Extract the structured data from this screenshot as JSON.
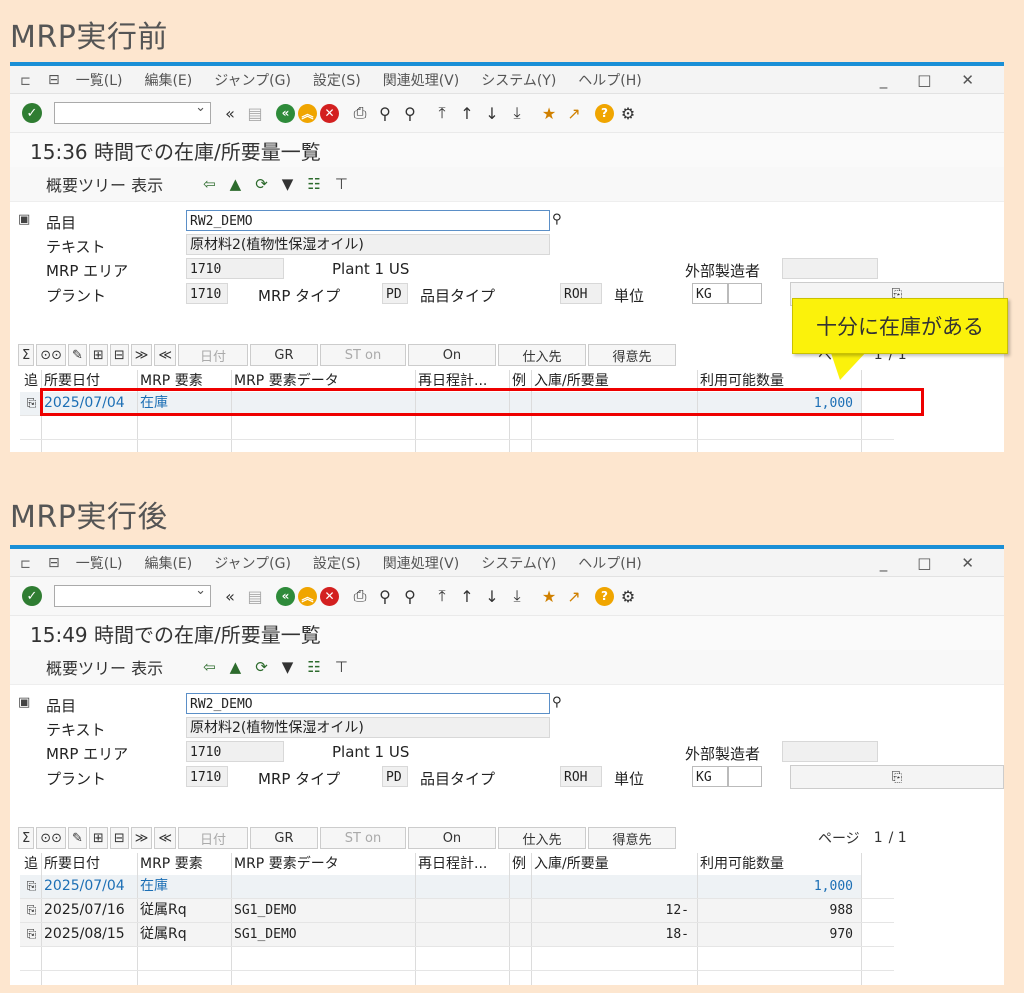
{
  "before": {
    "heading": "MRP実行前",
    "menu": [
      "一覧(L)",
      "編集(E)",
      "ジャンプ(G)",
      "設定(S)",
      "関連処理(V)",
      "システム(Y)",
      "ヘルプ(H)"
    ],
    "title": "15:36 時間での在庫/所要量一覧",
    "app_toolbar_label": "概要ツリー 表示",
    "labels": {
      "material": "品目",
      "text": "テキスト",
      "mrp_area": "MRP エリア",
      "plant": "プラント",
      "mrp_type": "MRP タイプ",
      "material_type": "品目タイプ",
      "unit": "単位",
      "external_mfr": "外部製造者",
      "plant_name": "Plant 1 US"
    },
    "values": {
      "material": "RW2_DEMO",
      "text": "原材料2(植物性保湿オイル)",
      "mrp_area": "1710",
      "plant": "1710",
      "mrp_type": "PD",
      "material_type": "ROH",
      "unit": "KG"
    },
    "grid_toolbar": {
      "date": "日付",
      "gr": "GR",
      "st": "ST on",
      "on": "On",
      "vendor": "仕入先",
      "customer": "得意先",
      "page_label": "ページ",
      "page": "1",
      "pages": "/ 1"
    },
    "columns": [
      "追",
      "所要日付",
      "MRP 要素",
      "MRP 要素データ",
      "再日程計...",
      "例",
      "入庫/所要量",
      "利用可能数量"
    ],
    "rows": [
      {
        "date": "2025/07/04",
        "element": "在庫",
        "data": "",
        "qty": "",
        "avail": "1,000"
      }
    ],
    "callout": "十分に在庫がある"
  },
  "after": {
    "heading": "MRP実行後",
    "menu": [
      "一覧(L)",
      "編集(E)",
      "ジャンプ(G)",
      "設定(S)",
      "関連処理(V)",
      "システム(Y)",
      "ヘルプ(H)"
    ],
    "title": "15:49 時間での在庫/所要量一覧",
    "app_toolbar_label": "概要ツリー 表示",
    "labels": {
      "material": "品目",
      "text": "テキスト",
      "mrp_area": "MRP エリア",
      "plant": "プラント",
      "mrp_type": "MRP タイプ",
      "material_type": "品目タイプ",
      "unit": "単位",
      "external_mfr": "外部製造者",
      "plant_name": "Plant 1 US"
    },
    "values": {
      "material": "RW2_DEMO",
      "text": "原材料2(植物性保湿オイル)",
      "mrp_area": "1710",
      "plant": "1710",
      "mrp_type": "PD",
      "material_type": "ROH",
      "unit": "KG"
    },
    "grid_toolbar": {
      "date": "日付",
      "gr": "GR",
      "st": "ST on",
      "on": "On",
      "vendor": "仕入先",
      "customer": "得意先",
      "page_label": "ページ",
      "page": "1",
      "pages": "/ 1"
    },
    "columns": [
      "追",
      "所要日付",
      "MRP 要素",
      "MRP 要素データ",
      "再日程計...",
      "例",
      "入庫/所要量",
      "利用可能数量"
    ],
    "rows": [
      {
        "date": "2025/07/04",
        "element": "在庫",
        "data": "",
        "qty": "",
        "avail": "1,000"
      },
      {
        "date": "2025/07/16",
        "element": "従属Rq",
        "data": "SG1_DEMO",
        "qty": "12-",
        "avail": "988"
      },
      {
        "date": "2025/08/15",
        "element": "従属Rq",
        "data": "SG1_DEMO",
        "qty": "18-",
        "avail": "970"
      }
    ]
  }
}
